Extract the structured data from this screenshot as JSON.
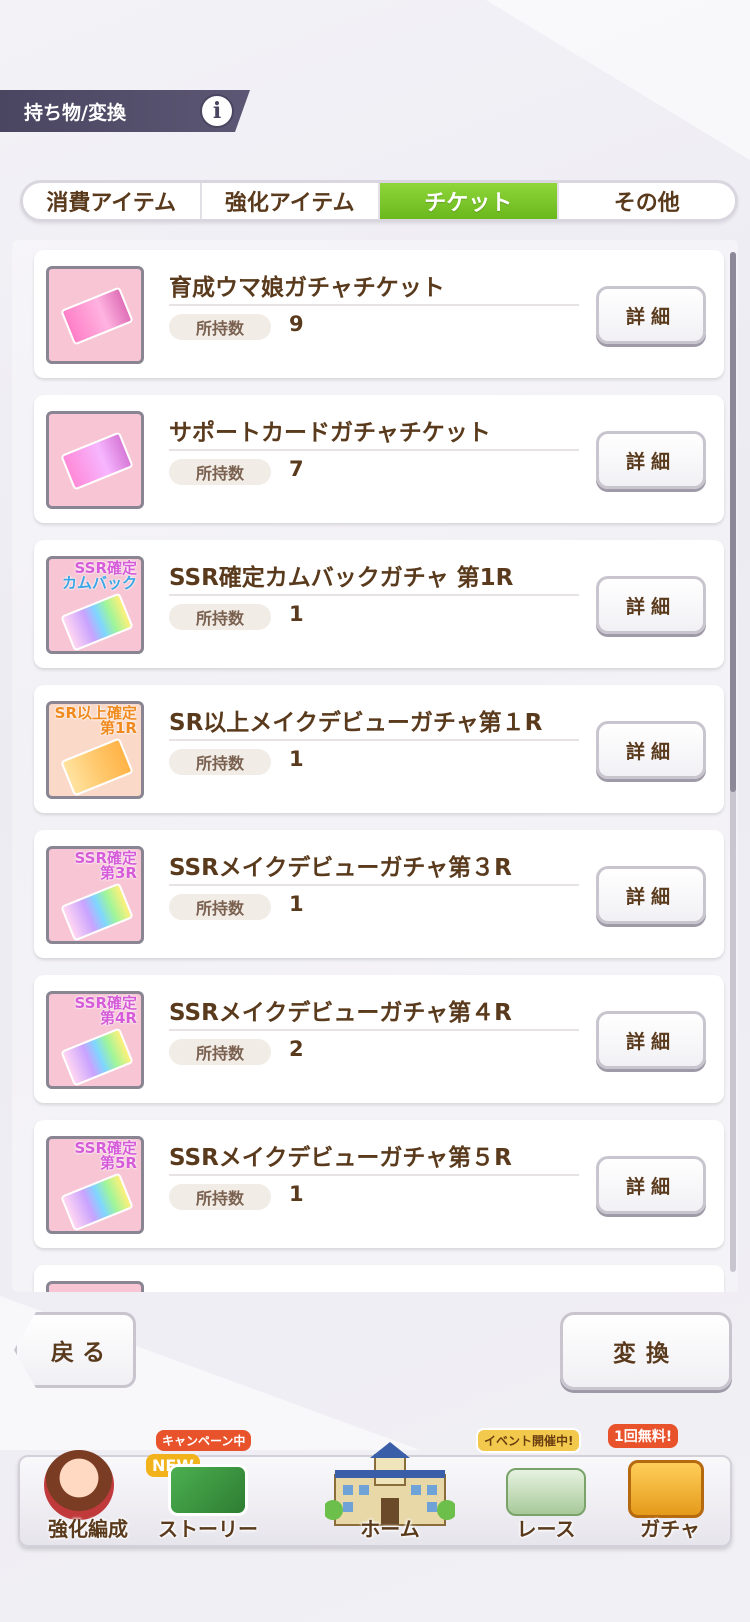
{
  "header": {
    "title": "持ち物/変換",
    "info_icon": "info-icon"
  },
  "tabs": [
    {
      "label": "消費アイテム",
      "active": false
    },
    {
      "label": "強化アイテム",
      "active": false
    },
    {
      "label": "チケット",
      "active": true
    },
    {
      "label": "その他",
      "active": false
    }
  ],
  "count_label": "所持数",
  "detail_label": "詳細",
  "items": [
    {
      "name": "育成ウマ娘ガチャチケット",
      "count": "9",
      "icon": "horse-ticket-icon",
      "icon_text": ""
    },
    {
      "name": "サポートカードガチャチケット",
      "count": "7",
      "icon": "support-ticket-icon",
      "icon_text": ""
    },
    {
      "name": "SSR確定カムバックガチャ 第1R",
      "count": "1",
      "icon": "ssr-comeback-ticket-icon",
      "icon_text": "SSR確定\nカムバック"
    },
    {
      "name": "SR以上メイクデビューガチャ第１R",
      "count": "1",
      "icon": "sr-ticket-icon",
      "icon_text": "SR以上確定\n第1R"
    },
    {
      "name": "SSRメイクデビューガチャ第３R",
      "count": "1",
      "icon": "ssr-ticket-icon",
      "icon_text": "SSR確定\n第3R"
    },
    {
      "name": "SSRメイクデビューガチャ第４R",
      "count": "2",
      "icon": "ssr-ticket-icon",
      "icon_text": "SSR確定\n第4R"
    },
    {
      "name": "SSRメイクデビューガチャ第５R",
      "count": "1",
      "icon": "ssr-ticket-icon",
      "icon_text": "SSR確定\n第5R"
    }
  ],
  "buttons": {
    "back": "戻る",
    "convert": "変換"
  },
  "nav": [
    {
      "label": "強化編成",
      "badge": ""
    },
    {
      "label": "ストーリー",
      "badge": "キャンペーン中",
      "badge2": "NEW"
    },
    {
      "label": "ホーム",
      "badge": ""
    },
    {
      "label": "レース",
      "badge": "イベント開催中!"
    },
    {
      "label": "ガチャ",
      "badge": "1回無料!"
    }
  ]
}
